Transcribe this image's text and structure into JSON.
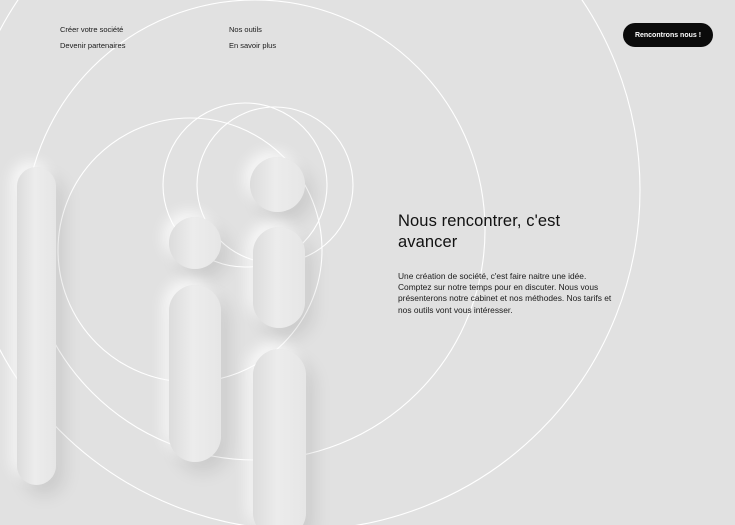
{
  "nav": {
    "left": [
      "Créer votre société",
      "Devenir partenaires"
    ],
    "right": [
      "Nos outils",
      "En savoir plus"
    ]
  },
  "cta": {
    "label": "Rencontrons nous !"
  },
  "hero": {
    "title": "Nous rencontrer, c'est avancer",
    "body": "Une création de société, c'est faire naitre une idée. Comptez sur notre temps pour en discuter. Nous vous présenterons notre cabinet et nos méthodes. Nos tarifs et nos outils vont vous intéresser."
  },
  "colors": {
    "background": "#e1e1e1",
    "cta_background": "#0b0b0b",
    "cta_text": "#ffffff",
    "ring_stroke": "#ffffff"
  }
}
